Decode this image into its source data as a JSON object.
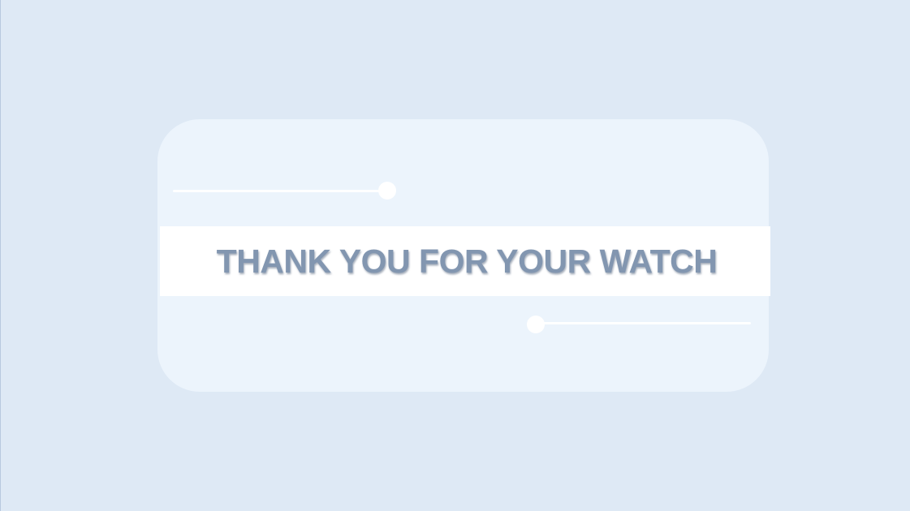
{
  "slide": {
    "title": "THANK YOU FOR YOUR WATCH"
  },
  "colors": {
    "background": "#dee9f5",
    "card": "#ecf4fc",
    "band": "#ffffff",
    "title_text": "#8296b0"
  }
}
